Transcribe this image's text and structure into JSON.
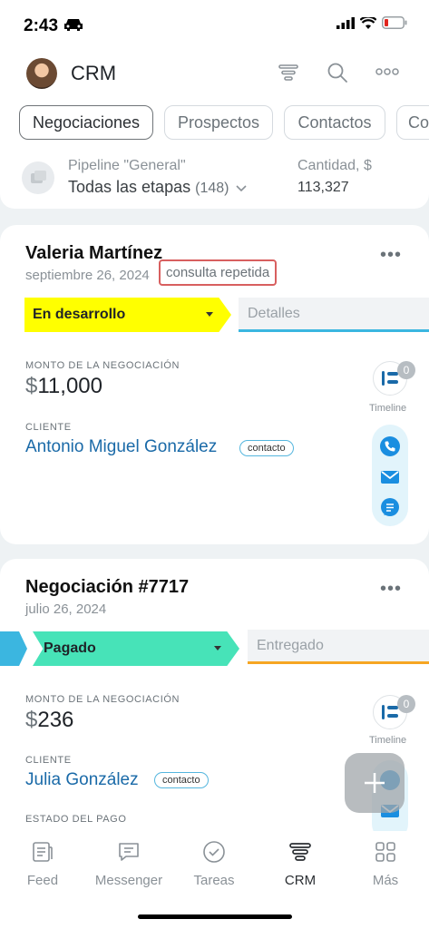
{
  "status_bar": {
    "time": "2:43"
  },
  "header": {
    "title": "CRM"
  },
  "tabs": [
    {
      "label": "Negociaciones",
      "active": true
    },
    {
      "label": "Prospectos",
      "active": false
    },
    {
      "label": "Contactos",
      "active": false
    },
    {
      "label": "Co",
      "active": false
    }
  ],
  "pipeline": {
    "label": "Pipeline \"General\"",
    "stages_label": "Todas las etapas",
    "stages_count": "(148)",
    "quantity_label": "Cantidad, $",
    "quantity_value": "113,327"
  },
  "deals": [
    {
      "title": "Valeria Martínez",
      "date": "septiembre 26, 2024",
      "badge": "consulta repetida",
      "stage": "En desarrollo",
      "stage_color": "#ffff00",
      "next_stage": "Detalles",
      "next_stage_color": "#3bb6e0",
      "amount_label": "MONTO DE LA NEGOCIACIÓN",
      "currency": "$",
      "amount": "11,000",
      "client_label": "CLIENTE",
      "client": "Antonio Miguel González",
      "client_type": "contacto",
      "timeline_count": "0",
      "timeline_label": "Timeline"
    },
    {
      "title": "Negociación #7717",
      "date": "julio 26, 2024",
      "stage": "Pagado",
      "stage_color": "#47e3b8",
      "next_stage": "Entregado",
      "next_stage_color": "#f6a623",
      "amount_label": "MONTO DE LA NEGOCIACIÓN",
      "currency": "$",
      "amount": "236",
      "client_label": "CLIENTE",
      "client": "Julia González",
      "client_type": "contacto",
      "payment_label": "ESTADO DEL PAGO",
      "timeline_count": "0",
      "timeline_label": "Timeline"
    }
  ],
  "bottom_nav": [
    {
      "label": "Feed",
      "icon": "feed-icon"
    },
    {
      "label": "Messenger",
      "icon": "messenger-icon"
    },
    {
      "label": "Tareas",
      "icon": "tasks-icon"
    },
    {
      "label": "CRM",
      "icon": "crm-icon",
      "active": true
    },
    {
      "label": "Más",
      "icon": "more-grid-icon"
    }
  ],
  "colors": {
    "link": "#1a6aa8",
    "accent": "#3bb6e0",
    "badge_border": "#d85f5f"
  }
}
